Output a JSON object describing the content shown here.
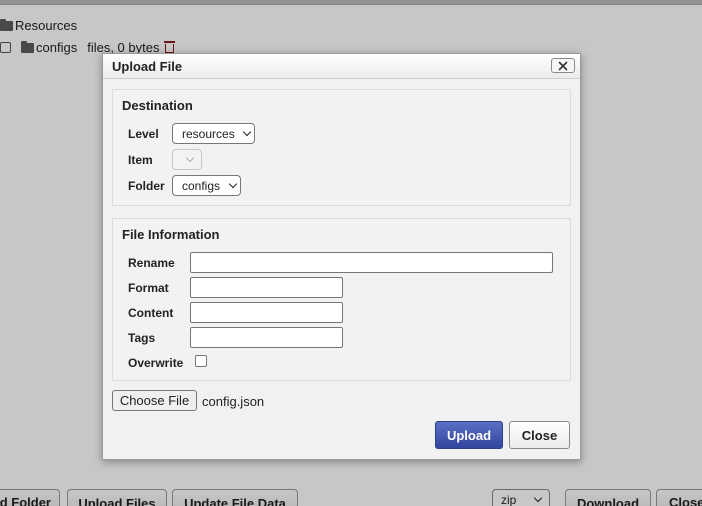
{
  "background": {
    "tree": {
      "root_label": "Resources",
      "child_label": "configs",
      "child_meta": "files, 0 bytes"
    },
    "buttons": {
      "add_folder": "d Folder",
      "upload_files": "Upload Files",
      "update_file_data": "Update File Data",
      "download": "Download",
      "close": "Close"
    },
    "format_select_value": "zip"
  },
  "dialog": {
    "title": "Upload File",
    "destination": {
      "legend": "Destination",
      "level_label": "Level",
      "level_value": "resources",
      "item_label": "Item",
      "item_value": "",
      "folder_label": "Folder",
      "folder_value": "configs"
    },
    "file_info": {
      "legend": "File Information",
      "rename_label": "Rename",
      "rename_value": "",
      "format_label": "Format",
      "format_value": "",
      "content_label": "Content",
      "content_value": "",
      "tags_label": "Tags",
      "tags_value": "",
      "overwrite_label": "Overwrite",
      "overwrite_checked": false
    },
    "choose_file_label": "Choose File",
    "chosen_file_name": "config.json",
    "upload_label": "Upload",
    "close_label": "Close"
  }
}
